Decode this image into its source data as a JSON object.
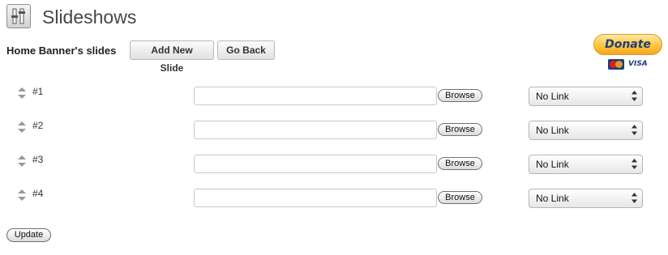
{
  "header": {
    "title": "Slideshows",
    "icon": "slideshow-settings-icon"
  },
  "section": {
    "title": "Home Banner's slides",
    "add_button": "Add New Slide",
    "back_button": "Go Back"
  },
  "donate": {
    "label": "Donate",
    "cards": [
      "mastercard-icon",
      "VISA"
    ]
  },
  "slides": [
    {
      "number": "#1",
      "url": "",
      "browse_label": "Browse",
      "link": "No Link"
    },
    {
      "number": "#2",
      "url": "",
      "browse_label": "Browse",
      "link": "No Link"
    },
    {
      "number": "#3",
      "url": "",
      "browse_label": "Browse",
      "link": "No Link"
    },
    {
      "number": "#4",
      "url": "",
      "browse_label": "Browse",
      "link": "No Link"
    }
  ],
  "footer": {
    "update_button": "Update"
  },
  "colors": {
    "title_text": "#464646",
    "donate_gold": "#ffc63f",
    "donate_text": "#1c3f7a"
  }
}
